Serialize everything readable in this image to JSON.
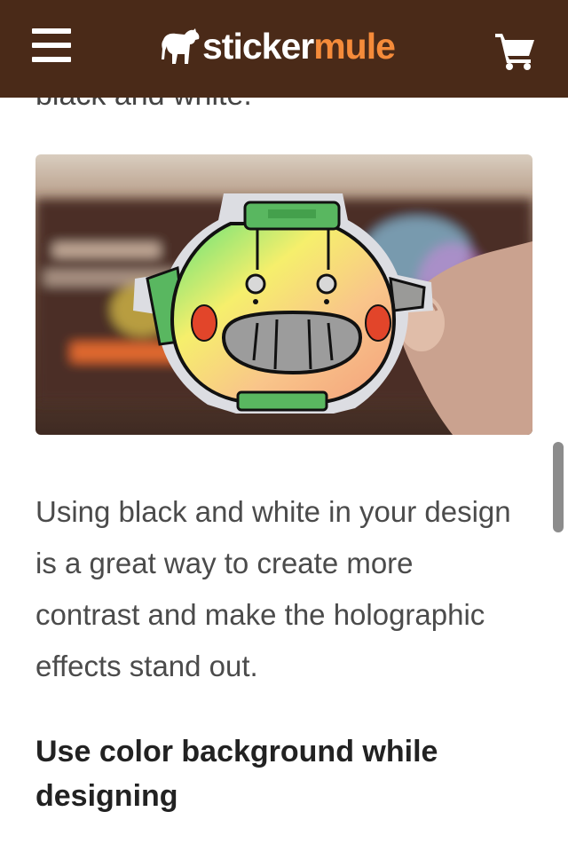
{
  "header": {
    "logo_part1": "sticker",
    "logo_part2": "mule",
    "brand_color": "#4a2a18",
    "accent_color": "#f58b3a",
    "menu_icon": "hamburger-menu-icon",
    "cart_icon": "shopping-cart-icon"
  },
  "article": {
    "clipped_text": "black and white.",
    "image_subject": "holographic-robot-sticker",
    "paragraph": "Using black and white in your design is a great way to create more contrast and make the holographic effects stand out.",
    "heading": "Use color background while designing"
  }
}
